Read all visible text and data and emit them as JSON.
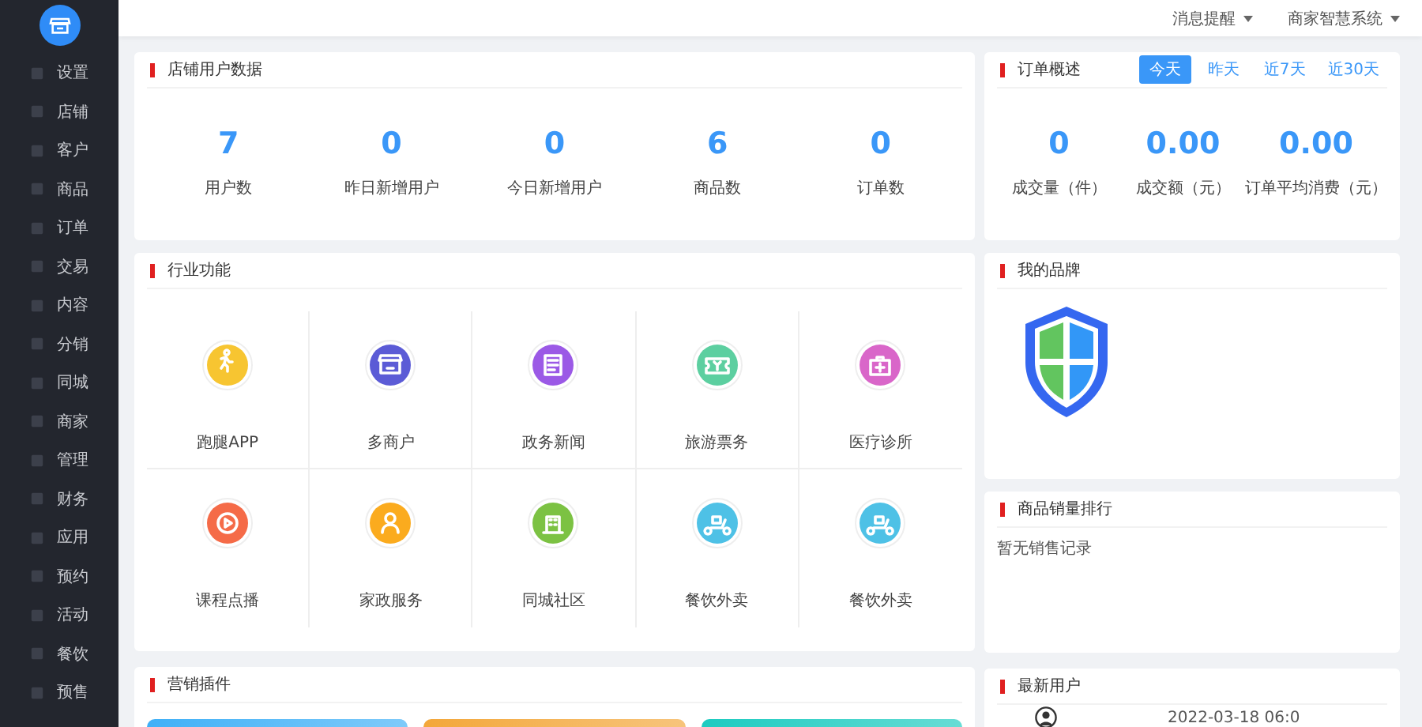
{
  "sidebar": {
    "items": [
      {
        "label": "设置"
      },
      {
        "label": "店铺"
      },
      {
        "label": "客户"
      },
      {
        "label": "商品"
      },
      {
        "label": "订单"
      },
      {
        "label": "交易"
      },
      {
        "label": "内容"
      },
      {
        "label": "分销"
      },
      {
        "label": "同城"
      },
      {
        "label": "商家"
      },
      {
        "label": "管理"
      },
      {
        "label": "财务"
      },
      {
        "label": "应用"
      },
      {
        "label": "预约"
      },
      {
        "label": "活动"
      },
      {
        "label": "餐饮"
      },
      {
        "label": "预售"
      }
    ]
  },
  "topbar": {
    "menus": [
      "消息提醒",
      "商家智慧系统"
    ]
  },
  "store_stats": {
    "title": "店铺用户数据",
    "stats": [
      {
        "value": "7",
        "label": "用户数"
      },
      {
        "value": "0",
        "label": "昨日新增用户"
      },
      {
        "value": "0",
        "label": "今日新增用户"
      },
      {
        "value": "6",
        "label": "商品数"
      },
      {
        "value": "0",
        "label": "订单数"
      }
    ]
  },
  "order_overview": {
    "title": "订单概述",
    "tabs": [
      {
        "label": "今天",
        "selected": true
      },
      {
        "label": "昨天",
        "selected": false
      },
      {
        "label": "近7天",
        "selected": false
      },
      {
        "label": "近30天",
        "selected": false
      }
    ],
    "stats": [
      {
        "value": "0",
        "label": "成交量（件）"
      },
      {
        "value": "0.00",
        "label": "成交额（元）"
      },
      {
        "value": "0.00",
        "label": "订单平均消费（元）"
      }
    ]
  },
  "industry": {
    "title": "行业功能",
    "items": [
      {
        "label": "跑腿APP",
        "color": "#f7c531"
      },
      {
        "label": "多商户",
        "color": "#5b5bd6"
      },
      {
        "label": "政务新闻",
        "color": "#9b59e6"
      },
      {
        "label": "旅游票务",
        "color": "#5ccfa0"
      },
      {
        "label": "医疗诊所",
        "color": "#d966c9"
      },
      {
        "label": "课程点播",
        "color": "#f56b48"
      },
      {
        "label": "家政服务",
        "color": "#fbab1e"
      },
      {
        "label": "同城社区",
        "color": "#7cc243"
      },
      {
        "label": "餐饮外卖",
        "color": "#4ec1e6"
      },
      {
        "label": "餐饮外卖",
        "color": "#4ec1e6"
      }
    ]
  },
  "brand": {
    "title": "我的品牌"
  },
  "sales_ranking": {
    "title": "商品销量排行",
    "empty_text": "暂无销售记录"
  },
  "marketing": {
    "title": "营销插件",
    "cards": [
      {
        "color": "#3fb0f7"
      },
      {
        "color": "#f3a73a"
      },
      {
        "color": "#1ccbc0"
      }
    ]
  },
  "latest_users": {
    "title": "最新用户",
    "rows": [
      {
        "time": "2022-03-18 06:0"
      }
    ]
  }
}
